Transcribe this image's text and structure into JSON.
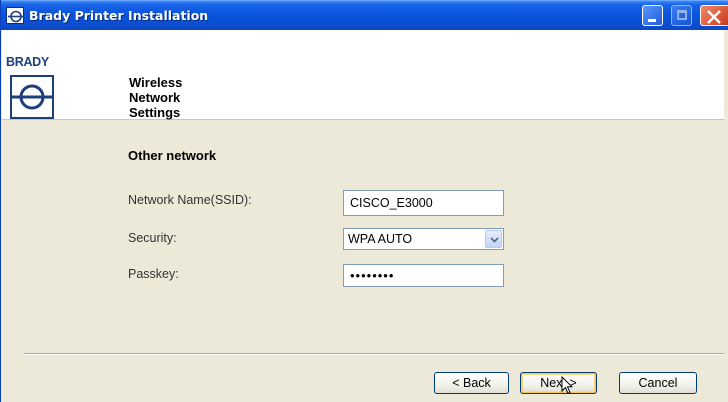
{
  "window": {
    "title": "Brady Printer Installation",
    "brand": "BRADY",
    "accent_color": "#0a55dc"
  },
  "header": {
    "title": "Wireless Network Settings"
  },
  "form": {
    "section_title": "Other network",
    "ssid_label": "Network Name(SSID):",
    "ssid_value": "CISCO_E3000",
    "security_label": "Security:",
    "security_value": "WPA AUTO",
    "passkey_label": "Passkey:",
    "passkey_masked": "••••••••"
  },
  "buttons": {
    "back": "< Back",
    "next": "Next >",
    "cancel": "Cancel"
  }
}
